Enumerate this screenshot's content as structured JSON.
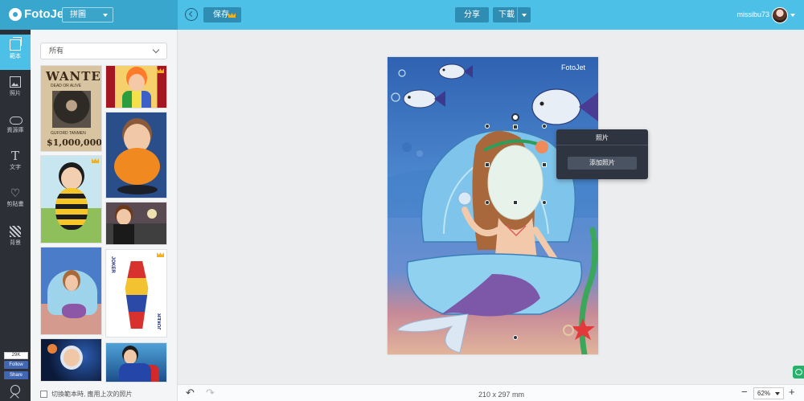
{
  "app": {
    "name": "FotoJet",
    "mode": "拼圖"
  },
  "toolbar": {
    "save_label": "保存",
    "share_label": "分享",
    "download_label": "下載"
  },
  "user": {
    "name": "missibu73"
  },
  "rail": {
    "items": [
      {
        "label": "範本",
        "icon": "templates-icon",
        "active": true
      },
      {
        "label": "照片",
        "icon": "photo-icon"
      },
      {
        "label": "資源庫",
        "icon": "cloud-icon"
      },
      {
        "label": "文字",
        "icon": "text-icon"
      },
      {
        "label": "剪貼畫",
        "icon": "heart-icon"
      },
      {
        "label": "背景",
        "icon": "background-icon"
      }
    ],
    "fb": {
      "count": "29K",
      "follow": "Follow",
      "share": "Share"
    }
  },
  "panel": {
    "filter": "所有",
    "thumbs": {
      "wanted_title": "WANTED",
      "wanted_sub": "DEAD OR ALIVE",
      "wanted_name": "GUFORD TANMEN",
      "wanted_amount": "$1,000,000",
      "joker_label": "JOKER"
    },
    "reuse_label": "切換範本時, 應用上次的照片"
  },
  "canvas": {
    "watermark": "FotoJet",
    "size_label": "210 x 297 mm",
    "zoom": "62%"
  },
  "popup": {
    "title": "照片",
    "add_label": "添加照片"
  },
  "colors": {
    "topbar": "#4cc0e6",
    "brand": "#39a7cd",
    "rail": "#2c2f36",
    "accent": "#4cc0e6",
    "crown": "#f2b01e"
  }
}
